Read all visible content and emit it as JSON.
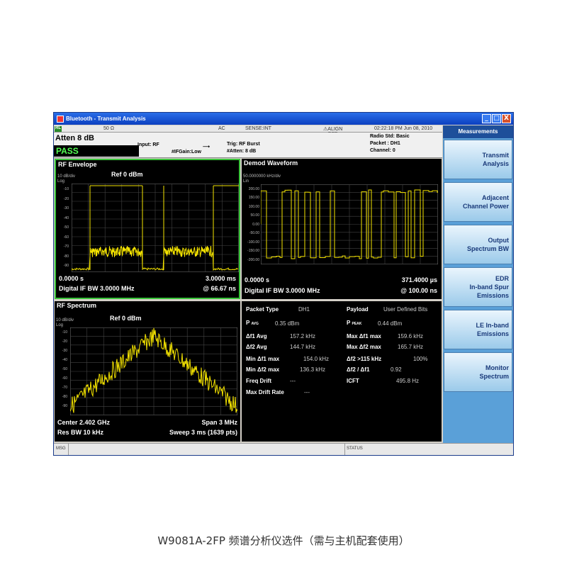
{
  "window": {
    "title": "Bluetooth - Transmit Analysis",
    "controls": [
      "_",
      "□",
      "X"
    ]
  },
  "status": {
    "indicator": "RL",
    "impedance": "50 Ω",
    "coupling": "AC",
    "sense": "SENSE:INT",
    "align": "ALIGN OFF",
    "datetime": "02:22:18 PM Jun 08, 2010"
  },
  "info": {
    "atten": "Atten  8 dB",
    "pass": "PASS",
    "input": "Input: RF",
    "ifgain": "#IFGain:Low",
    "trig": "Trig: RF Burst",
    "atten2": "#Atten: 8 dB",
    "radio_std": "Radio Std: Basic",
    "packet": "Packet : DH1",
    "channel": "Channel: 0"
  },
  "sidebar": {
    "title": "Measurements",
    "items": [
      {
        "line1": "Transmit",
        "line2": "Analysis"
      },
      {
        "line1": "Adjacent",
        "line2": "Channel Power"
      },
      {
        "line1": "Output",
        "line2": "Spectrum BW"
      },
      {
        "line1": "EDR",
        "line2": "In-band Spur",
        "line3": "Emissions"
      },
      {
        "line1": "LE In-band",
        "line2": "Emissions"
      },
      {
        "line1": "Monitor",
        "line2": "Spectrum"
      }
    ]
  },
  "rf_envelope": {
    "title": "RF Envelope",
    "scale": "10 dB/div",
    "ref": "Ref  0 dBm",
    "log": "Log",
    "ticks": [
      "-10",
      "-20",
      "-30",
      "-40",
      "-50",
      "-60",
      "-70",
      "-80",
      "-90"
    ],
    "start": "0.0000 s",
    "stop": "3.0000 ms",
    "if_bw": "Digital IF BW 3.0000 MHz",
    "res": "@ 66.67 ns"
  },
  "demod": {
    "title": "Demod Waveform",
    "scale": "50.0000000 kHz/div",
    "lin": "Lin",
    "ticks": [
      "200.00",
      "150.00",
      "100.00",
      "50.00",
      "0.00",
      "-50.00",
      "-100.00",
      "-150.00",
      "-200.00"
    ],
    "start": "0.0000 s",
    "stop": "371.4000 µs",
    "if_bw": "Digital IF BW 3.0000 MHz",
    "res": "@ 100.00 ns"
  },
  "rf_spectrum": {
    "title": "RF Spectrum",
    "scale": "10 dB/div",
    "ref": "Ref  0 dBm",
    "log": "Log",
    "ticks": [
      "-10",
      "-20",
      "-30",
      "-40",
      "-50",
      "-60",
      "-70",
      "-80",
      "-90"
    ],
    "center": "Center  2.402 GHz",
    "span": "Span 3 MHz",
    "res_bw": "Res BW  10 kHz",
    "sweep": "Sweep  3 ms (1639 pts)"
  },
  "results": {
    "packet_type_label": "Packet Type",
    "packet_type_value": "DH1",
    "payload_label": "Payload",
    "payload_value": "User Defined Bits",
    "pavg_label": "P",
    "pavg_sub": "AVG",
    "pavg_value": "0.35 dBm",
    "ppeak_label": "P",
    "ppeak_sub": "PEAK",
    "ppeak_value": "0.44 dBm",
    "df1avg_label": "Δf1 Avg",
    "df1avg_value": "157.2 kHz",
    "maxdf1_label": "Max Δf1 max",
    "maxdf1_value": "159.6 kHz",
    "df2avg_label": "Δf2 Avg",
    "df2avg_value": "144.7 kHz",
    "maxdf2_label": "Max Δf2 max",
    "maxdf2_value": "165.7 kHz",
    "mindf1_label": "Min Δf1 max",
    "mindf1_value": "154.0 kHz",
    "df2gt_label": "Δf2 >115 kHz",
    "df2gt_value": "100%",
    "mindf2_label": "Min Δf2 max",
    "mindf2_value": "136.3 kHz",
    "ratio_label": "Δf2 / Δf1",
    "ratio_value": "0.92",
    "drift_label": "Freq Drift",
    "drift_value": "---",
    "icft_label": "ICFT",
    "icft_value": "495.8 Hz",
    "maxdrift_label": "Max Drift Rate",
    "maxdrift_value": "---"
  },
  "bottom": {
    "msg": "MSG",
    "status": "STATUS"
  },
  "caption": "W9081A-2FP 频谱分析仪选件（需与主机配套使用）",
  "colors": {
    "trace": "#f5e400",
    "selected_border": "#3ac43a",
    "pass_text": "#55ff55"
  }
}
